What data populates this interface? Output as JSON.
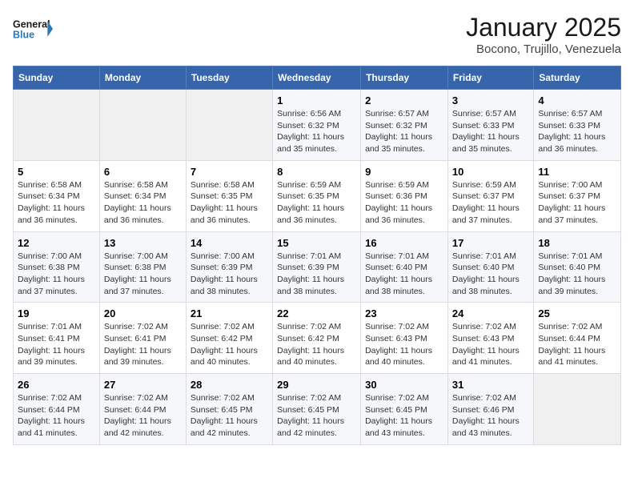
{
  "header": {
    "logo_line1": "General",
    "logo_line2": "Blue",
    "month": "January 2025",
    "location": "Bocono, Trujillo, Venezuela"
  },
  "days_of_week": [
    "Sunday",
    "Monday",
    "Tuesday",
    "Wednesday",
    "Thursday",
    "Friday",
    "Saturday"
  ],
  "weeks": [
    [
      {
        "day": "",
        "info": ""
      },
      {
        "day": "",
        "info": ""
      },
      {
        "day": "",
        "info": ""
      },
      {
        "day": "1",
        "info": "Sunrise: 6:56 AM\nSunset: 6:32 PM\nDaylight: 11 hours and 35 minutes."
      },
      {
        "day": "2",
        "info": "Sunrise: 6:57 AM\nSunset: 6:32 PM\nDaylight: 11 hours and 35 minutes."
      },
      {
        "day": "3",
        "info": "Sunrise: 6:57 AM\nSunset: 6:33 PM\nDaylight: 11 hours and 35 minutes."
      },
      {
        "day": "4",
        "info": "Sunrise: 6:57 AM\nSunset: 6:33 PM\nDaylight: 11 hours and 36 minutes."
      }
    ],
    [
      {
        "day": "5",
        "info": "Sunrise: 6:58 AM\nSunset: 6:34 PM\nDaylight: 11 hours and 36 minutes."
      },
      {
        "day": "6",
        "info": "Sunrise: 6:58 AM\nSunset: 6:34 PM\nDaylight: 11 hours and 36 minutes."
      },
      {
        "day": "7",
        "info": "Sunrise: 6:58 AM\nSunset: 6:35 PM\nDaylight: 11 hours and 36 minutes."
      },
      {
        "day": "8",
        "info": "Sunrise: 6:59 AM\nSunset: 6:35 PM\nDaylight: 11 hours and 36 minutes."
      },
      {
        "day": "9",
        "info": "Sunrise: 6:59 AM\nSunset: 6:36 PM\nDaylight: 11 hours and 36 minutes."
      },
      {
        "day": "10",
        "info": "Sunrise: 6:59 AM\nSunset: 6:37 PM\nDaylight: 11 hours and 37 minutes."
      },
      {
        "day": "11",
        "info": "Sunrise: 7:00 AM\nSunset: 6:37 PM\nDaylight: 11 hours and 37 minutes."
      }
    ],
    [
      {
        "day": "12",
        "info": "Sunrise: 7:00 AM\nSunset: 6:38 PM\nDaylight: 11 hours and 37 minutes."
      },
      {
        "day": "13",
        "info": "Sunrise: 7:00 AM\nSunset: 6:38 PM\nDaylight: 11 hours and 37 minutes."
      },
      {
        "day": "14",
        "info": "Sunrise: 7:00 AM\nSunset: 6:39 PM\nDaylight: 11 hours and 38 minutes."
      },
      {
        "day": "15",
        "info": "Sunrise: 7:01 AM\nSunset: 6:39 PM\nDaylight: 11 hours and 38 minutes."
      },
      {
        "day": "16",
        "info": "Sunrise: 7:01 AM\nSunset: 6:40 PM\nDaylight: 11 hours and 38 minutes."
      },
      {
        "day": "17",
        "info": "Sunrise: 7:01 AM\nSunset: 6:40 PM\nDaylight: 11 hours and 38 minutes."
      },
      {
        "day": "18",
        "info": "Sunrise: 7:01 AM\nSunset: 6:40 PM\nDaylight: 11 hours and 39 minutes."
      }
    ],
    [
      {
        "day": "19",
        "info": "Sunrise: 7:01 AM\nSunset: 6:41 PM\nDaylight: 11 hours and 39 minutes."
      },
      {
        "day": "20",
        "info": "Sunrise: 7:02 AM\nSunset: 6:41 PM\nDaylight: 11 hours and 39 minutes."
      },
      {
        "day": "21",
        "info": "Sunrise: 7:02 AM\nSunset: 6:42 PM\nDaylight: 11 hours and 40 minutes."
      },
      {
        "day": "22",
        "info": "Sunrise: 7:02 AM\nSunset: 6:42 PM\nDaylight: 11 hours and 40 minutes."
      },
      {
        "day": "23",
        "info": "Sunrise: 7:02 AM\nSunset: 6:43 PM\nDaylight: 11 hours and 40 minutes."
      },
      {
        "day": "24",
        "info": "Sunrise: 7:02 AM\nSunset: 6:43 PM\nDaylight: 11 hours and 41 minutes."
      },
      {
        "day": "25",
        "info": "Sunrise: 7:02 AM\nSunset: 6:44 PM\nDaylight: 11 hours and 41 minutes."
      }
    ],
    [
      {
        "day": "26",
        "info": "Sunrise: 7:02 AM\nSunset: 6:44 PM\nDaylight: 11 hours and 41 minutes."
      },
      {
        "day": "27",
        "info": "Sunrise: 7:02 AM\nSunset: 6:44 PM\nDaylight: 11 hours and 42 minutes."
      },
      {
        "day": "28",
        "info": "Sunrise: 7:02 AM\nSunset: 6:45 PM\nDaylight: 11 hours and 42 minutes."
      },
      {
        "day": "29",
        "info": "Sunrise: 7:02 AM\nSunset: 6:45 PM\nDaylight: 11 hours and 42 minutes."
      },
      {
        "day": "30",
        "info": "Sunrise: 7:02 AM\nSunset: 6:45 PM\nDaylight: 11 hours and 43 minutes."
      },
      {
        "day": "31",
        "info": "Sunrise: 7:02 AM\nSunset: 6:46 PM\nDaylight: 11 hours and 43 minutes."
      },
      {
        "day": "",
        "info": ""
      }
    ]
  ]
}
